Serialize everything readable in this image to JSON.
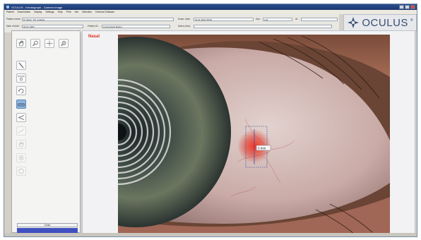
{
  "window": {
    "title": "OCULUS - Keratograph - Camera Image",
    "controls": [
      "minimize",
      "maximize",
      "close"
    ]
  },
  "menu": {
    "items": [
      "Patient",
      "Examination",
      "Display",
      "Settings",
      "Help",
      "Print",
      "Info",
      "Selection",
      "External Software"
    ]
  },
  "patient_info": {
    "name_label": "Patient name:",
    "name_value": "M_Meier_K5_Imaging",
    "dob_label": "Date of birth:",
    "dob_value": "01.01.1953",
    "pid_label": "Patient ID:",
    "pid_value": "Conjunctival Redng",
    "exam_date_label": "Exam. date:",
    "exam_date_value": "30.11.2010 08:20",
    "eye_label": "Eye:",
    "eye_value": "Left",
    "id_label": "ID:",
    "id_value": "",
    "notes_label": "Notes (Info):",
    "notes_value": ""
  },
  "logo": {
    "text": "OCULUS",
    "mark": "®"
  },
  "tools": [
    {
      "icon": "hand-icon",
      "state": "normal"
    },
    {
      "icon": "magnifier-icon",
      "state": "normal"
    },
    {
      "icon": "crosshair-icon",
      "state": "normal"
    },
    {
      "icon": "zoom-icon",
      "state": "normal"
    },
    {
      "icon": "pencil-icon",
      "state": "normal"
    },
    {
      "icon": "measure-icon",
      "state": "normal"
    },
    {
      "icon": "rotate-icon",
      "state": "normal"
    },
    {
      "icon": "ruler-icon",
      "state": "active"
    },
    {
      "icon": "angle-icon",
      "state": "normal"
    },
    {
      "icon": "line-tool-icon",
      "state": "disabled"
    },
    {
      "icon": "hand-alt-icon",
      "state": "disabled"
    },
    {
      "icon": "circle-target-icon",
      "state": "disabled"
    },
    {
      "icon": "circle-icon",
      "state": "disabled"
    }
  ],
  "close_button": {
    "label": "Close"
  },
  "viewer": {
    "side_label": "Nasal",
    "measurement_tag": "0 mm"
  },
  "colors": {
    "title_bar": "#1a3670",
    "side_label": "#e03020",
    "active_tool": "#8fb6e0",
    "progress_bar": "#4050c0",
    "measure_marker": "#d83028"
  }
}
